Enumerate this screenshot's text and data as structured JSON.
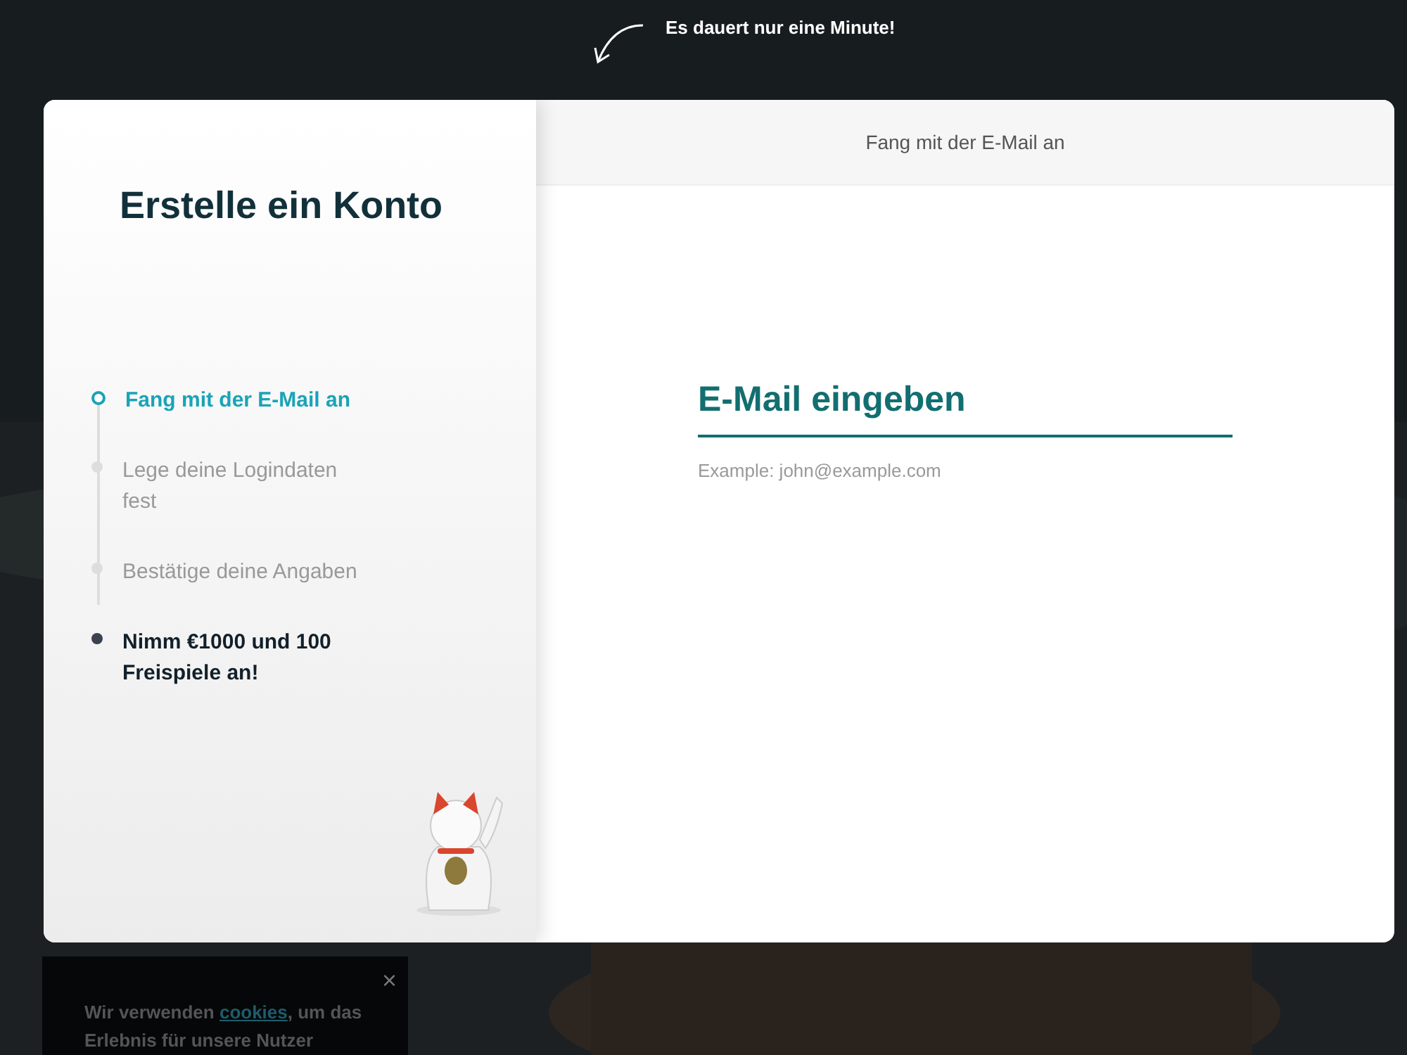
{
  "hint": {
    "text": "Es dauert nur eine Minute!"
  },
  "sidebar": {
    "title": "Erstelle ein Konto",
    "steps": [
      {
        "label": "Fang mit der E-Mail an",
        "kind": "step",
        "selected": true
      },
      {
        "label": "Lege deine Logindaten fest",
        "kind": "step",
        "selected": false
      },
      {
        "label": "Bestätige deine Angaben",
        "kind": "step",
        "selected": false
      },
      {
        "label": "Nimm €1000 und 100 Freispiele an!",
        "kind": "reward",
        "selected": false
      }
    ]
  },
  "main": {
    "header": "Fang mit der E-Mail an",
    "email_field": {
      "placeholder": "E-Mail eingeben",
      "hint": "Example: john@example.com"
    }
  },
  "cookie_banner": {
    "close": "×",
    "before": "Wir verwenden ",
    "link": "cookies",
    "after": ", um das Erlebnis für unsere Nutzer"
  }
}
